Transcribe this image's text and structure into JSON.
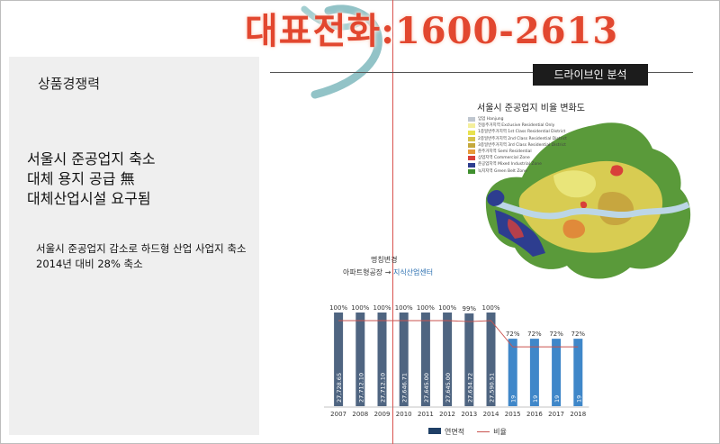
{
  "banner": {
    "text": "대표전화:1600-2613"
  },
  "left_panel": {
    "section_title": "상품경쟁력",
    "headline": [
      "서울시 준공업지 축소",
      "대체 용지 공급 無",
      "대체산업시설 요구됨"
    ],
    "detail": [
      "서울시 준공업지 감소로 하드형 산업 사업지 축소",
      "2014년 대비 28% 축소"
    ]
  },
  "drive_label": "드라이브인 분석",
  "map": {
    "title": "서울시 준공업지 비율 변화도",
    "legend": [
      {
        "label": "임업 Hanjung",
        "color": "#bfc6cf"
      },
      {
        "label": "전용주거지역 Exclusive Residential Only",
        "color": "#f4ef9c"
      },
      {
        "label": "1종일반주거지역 1st Class Residential District",
        "color": "#e8e24f"
      },
      {
        "label": "2종일반주거지역 2nd Class Residential District",
        "color": "#d6c24a"
      },
      {
        "label": "3종일반주거지역 3rd Class Residential District",
        "color": "#c4a83c"
      },
      {
        "label": "준주거지역 Semi Residential",
        "color": "#e79b3a"
      },
      {
        "label": "상업지역 Commercial Zone",
        "color": "#d8403a"
      },
      {
        "label": "준공업지역 Mixed Industrial Zone",
        "color": "#2d3d8f"
      },
      {
        "label": "녹지지역 Green Belt Zone",
        "color": "#3f8f2e"
      }
    ]
  },
  "chart_note": {
    "title": "명칭변경",
    "from": "아파트형공장 →",
    "to": "지식산업센터"
  },
  "chart_data": {
    "type": "bar",
    "categories": [
      "2007",
      "2008",
      "2009",
      "2010",
      "2011",
      "2012",
      "2013",
      "2014",
      "2015",
      "2016",
      "2017",
      "2018"
    ],
    "series": [
      {
        "name": "연면적",
        "bar_labels": [
          "27,728.65",
          "27,712.10",
          "27,712.10",
          "27,646.71",
          "27,645.00",
          "27,645.00",
          "27,634.72",
          "27,590.51",
          "19",
          "19",
          "19",
          "19"
        ]
      },
      {
        "name": "비율",
        "values": [
          100,
          100,
          100,
          100,
          100,
          100,
          99,
          100,
          72,
          72,
          72,
          72
        ],
        "labels": [
          "100%",
          "100%",
          "100%",
          "100%",
          "100%",
          "100%",
          "99%",
          "100%",
          "72%",
          "72%",
          "72%",
          "72%"
        ]
      }
    ],
    "ylim": [
      0,
      100
    ],
    "colors": {
      "before": "#4f6581",
      "after": "#3f87c9",
      "line": "#c9534f"
    }
  }
}
